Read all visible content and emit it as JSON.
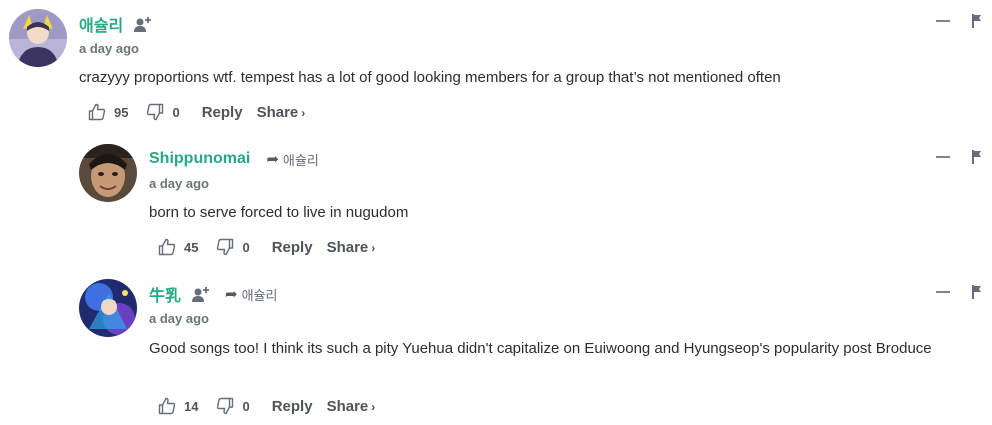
{
  "comments": [
    {
      "username": "애슐리",
      "time": "a day ago",
      "text": "crazyyy proportions wtf. tempest has a lot of good looking members for a group that’s not mentioned often",
      "likes": "95",
      "dislikes": "0",
      "reply_label": "Reply",
      "share_label": "Share",
      "share_chevron": "›"
    },
    {
      "username": "Shippunomai",
      "reply_to": "애슐리",
      "time": "a day ago",
      "text": "born to serve forced to live in nugudom",
      "likes": "45",
      "dislikes": "0",
      "reply_label": "Reply",
      "share_label": "Share",
      "share_chevron": "›"
    },
    {
      "username": "牛乳",
      "reply_to": "애슐리",
      "time": "a day ago",
      "text": "Good songs too! I think its such a pity Yuehua didn't capitalize on Euiwoong and Hyungseop's popularity post Broduce",
      "likes": "14",
      "dislikes": "0",
      "reply_label": "Reply",
      "share_label": "Share",
      "share_chevron": "›"
    }
  ],
  "icons": {
    "follow": "follow-user-icon",
    "reply_arrow": "reply-arrow-icon",
    "upvote": "thumbs-up-icon",
    "downvote": "thumbs-down-icon",
    "collapse": "minus-icon",
    "flag": "flag-icon"
  },
  "colors": {
    "username": "#26a985",
    "text": "#2a2e2e",
    "meta": "#656c7a"
  }
}
